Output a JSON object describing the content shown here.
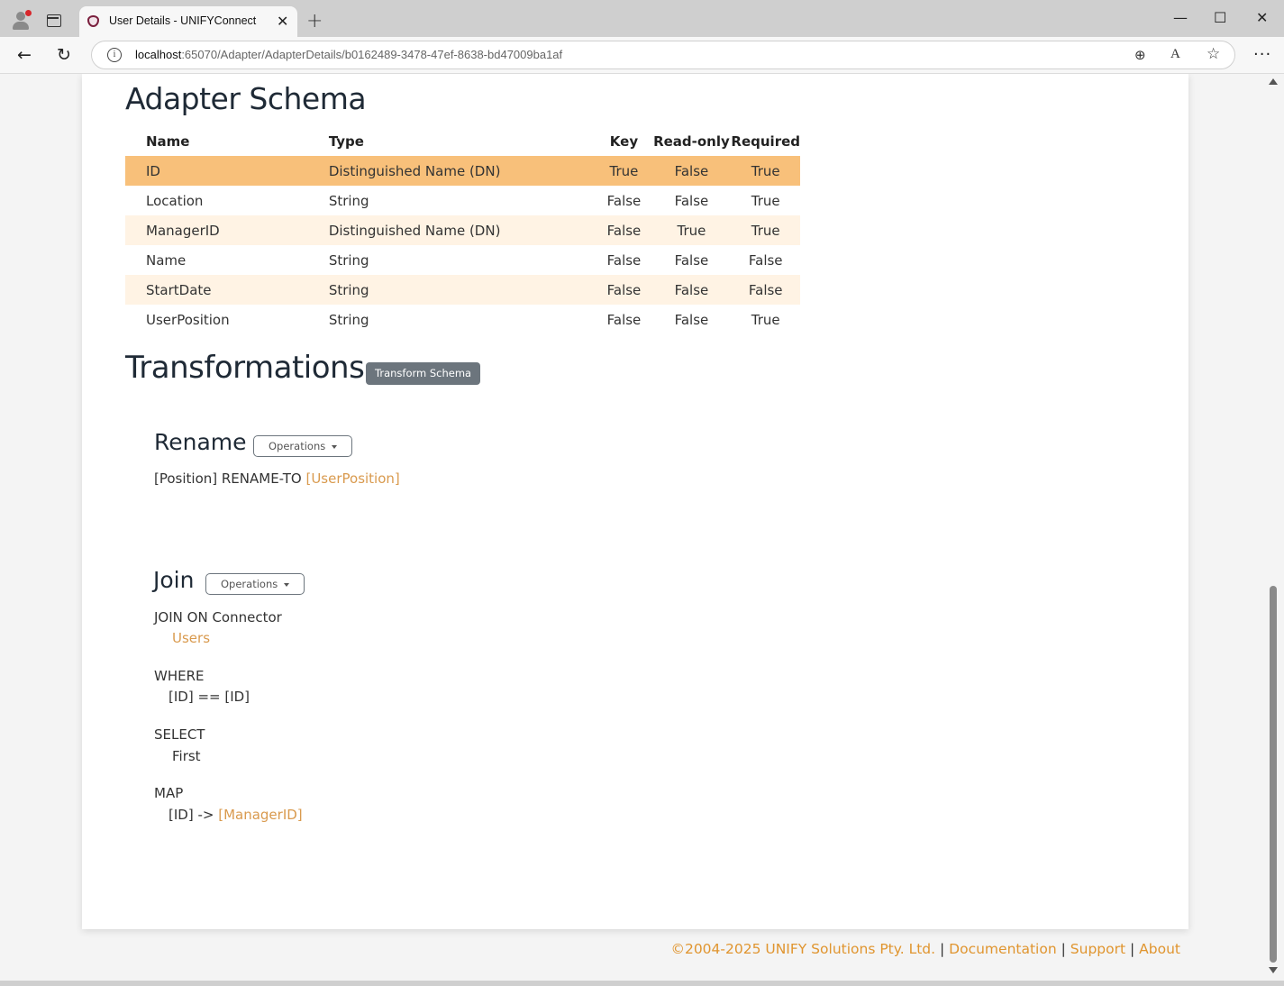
{
  "browser": {
    "tab_title": "User Details - UNIFYConnect",
    "tab_close": "✕",
    "new_tab": "+",
    "url_host": "localhost",
    "url_path": ":65070/Adapter/AdapterDetails/b0162489-3478-47ef-8638-bd47009ba1af",
    "info_glyph": "i",
    "back_glyph": "←",
    "refresh_glyph": "↻",
    "zoom_glyph": "⊕",
    "read_glyph": "A",
    "fav_glyph": "☆",
    "more_glyph": "···",
    "minimize_glyph": "—",
    "maximize_glyph": "☐",
    "close_glyph": "✕"
  },
  "schema": {
    "title": "Adapter Schema",
    "columns": [
      "Name",
      "Type",
      "Key",
      "Read-only",
      "Required"
    ],
    "rows": [
      {
        "name": "ID",
        "type": "Distinguished Name (DN)",
        "key": "True",
        "readonly": "False",
        "required": "True"
      },
      {
        "name": "Location",
        "type": "String",
        "key": "False",
        "readonly": "False",
        "required": "True"
      },
      {
        "name": "ManagerID",
        "type": "Distinguished Name (DN)",
        "key": "False",
        "readonly": "True",
        "required": "True"
      },
      {
        "name": "Name",
        "type": "String",
        "key": "False",
        "readonly": "False",
        "required": "False"
      },
      {
        "name": "StartDate",
        "type": "String",
        "key": "False",
        "readonly": "False",
        "required": "False"
      },
      {
        "name": "UserPosition",
        "type": "String",
        "key": "False",
        "readonly": "False",
        "required": "True"
      }
    ]
  },
  "transformations": {
    "title": "Transformations",
    "transform_button": "Transform Schema",
    "rename": {
      "title": "Rename",
      "operations_label": "Operations",
      "source": "[Position] RENAME-TO",
      "target": "[UserPosition]"
    },
    "join": {
      "title": "Join",
      "operations_label": "Operations",
      "join_on": "JOIN ON Connector",
      "connector": "Users",
      "where_label": "WHERE",
      "where_clause": "[ID] == [ID]",
      "select_label": "SELECT",
      "select_value": "First",
      "map_label": "MAP",
      "map_source": "[ID] ->",
      "map_target": "[ManagerID]"
    }
  },
  "footer": {
    "copyright": "©2004-2025 UNIFY Solutions Pty. Ltd.",
    "separator": "|",
    "documentation": "Documentation",
    "support": "Support",
    "about": "About"
  },
  "colors": {
    "selected_row": "#f8c07a",
    "alt_row": "#fff3e4",
    "link": "#e0952f",
    "button_secondary": "#6c757d"
  }
}
